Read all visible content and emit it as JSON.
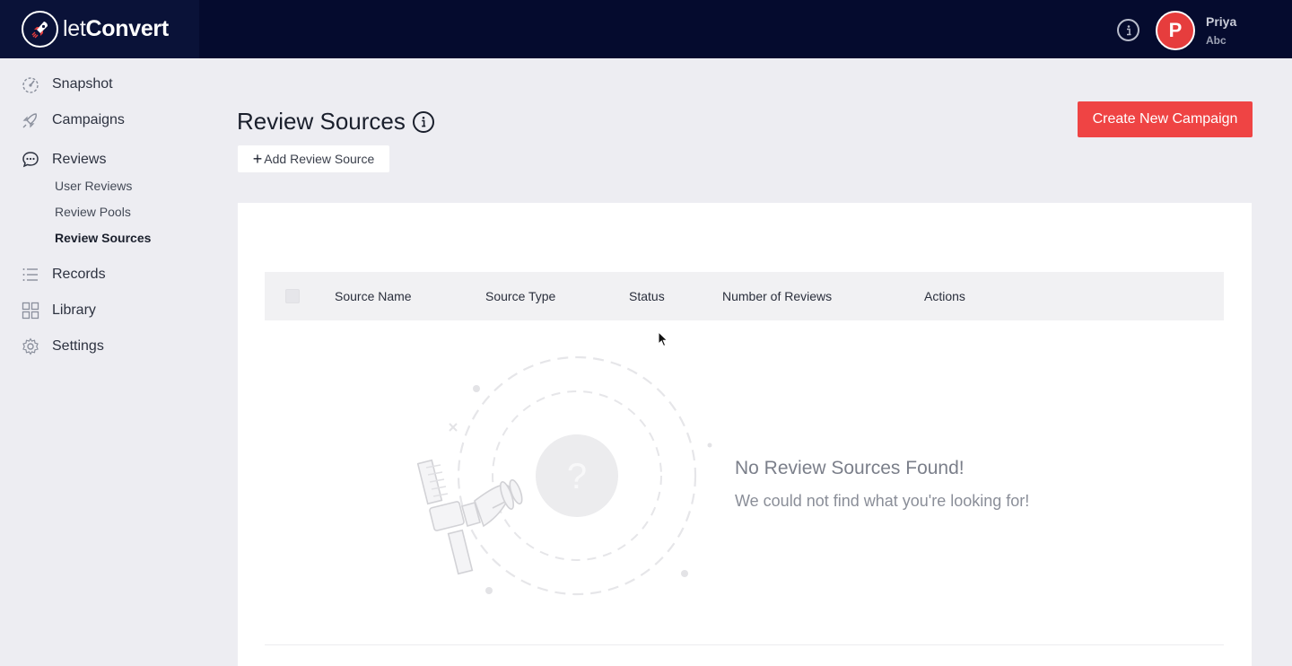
{
  "header": {
    "logo_prefix": "let",
    "logo_suffix": "Convert",
    "user_initial": "P",
    "user_name": "Priya",
    "user_org": "Abc"
  },
  "sidebar": {
    "items": [
      {
        "label": "Snapshot",
        "icon": "gauge-icon"
      },
      {
        "label": "Campaigns",
        "icon": "rocket-icon"
      },
      {
        "label": "Reviews",
        "icon": "chat-bubble-icon"
      },
      {
        "label": "Records",
        "icon": "list-icon"
      },
      {
        "label": "Library",
        "icon": "grid-icon"
      },
      {
        "label": "Settings",
        "icon": "gear-icon"
      }
    ],
    "review_subitems": [
      "User Reviews",
      "Review Pools",
      "Review Sources"
    ],
    "active_subitem": "Review Sources"
  },
  "main": {
    "title": "Review Sources",
    "add_button": "Add Review Source",
    "create_button": "Create New Campaign",
    "table": {
      "columns": [
        "Source Name",
        "Source Type",
        "Status",
        "Number of Reviews",
        "Actions"
      ]
    },
    "empty": {
      "title": "No Review Sources Found!",
      "subtitle": "We could not find what you're looking for!",
      "glyph": "?"
    }
  },
  "colors": {
    "topbar": "#050b2e",
    "accent": "#ef4444",
    "avatar": "#e63d3d",
    "background": "#ededf2"
  }
}
